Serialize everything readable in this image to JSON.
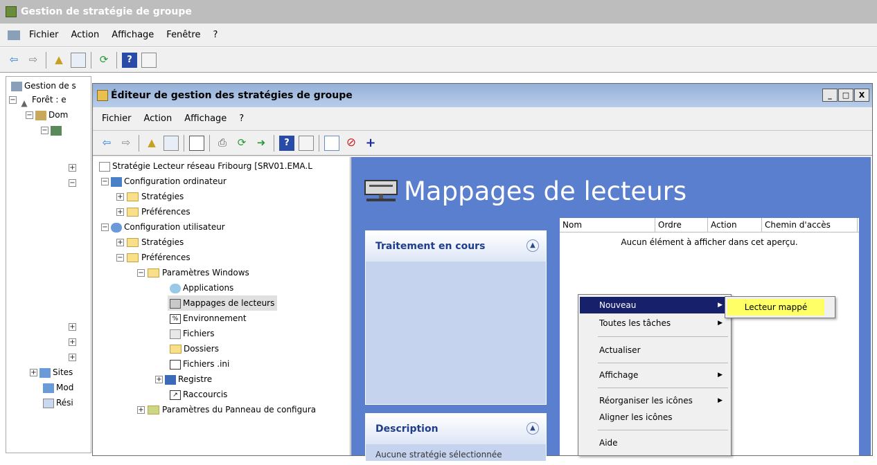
{
  "outer": {
    "title": "Gestion de stratégie de groupe",
    "menu": [
      "Fichier",
      "Action",
      "Affichage",
      "Fenêtre",
      "?"
    ],
    "tree": [
      "Gestion de s",
      "Forêt : e",
      "Dom",
      "Sites",
      "Mod",
      "Rési"
    ]
  },
  "inner": {
    "title": "Éditeur de gestion des stratégies de groupe",
    "window_buttons": [
      "_",
      "□",
      "X"
    ],
    "menu": [
      "Fichier",
      "Action",
      "Affichage",
      "?"
    ],
    "tree": {
      "root": "Stratégie Lecteur réseau Fribourg [SRV01.EMA.L",
      "comp_config": "Configuration ordinateur",
      "comp_strategies": "Stratégies",
      "comp_preferences": "Préférences",
      "user_config": "Configuration utilisateur",
      "user_strategies": "Stratégies",
      "user_preferences": "Préférences",
      "win_params": "Paramètres Windows",
      "applications": "Applications",
      "drive_maps": "Mappages de lecteurs",
      "environment": "Environnement",
      "files": "Fichiers",
      "folders": "Dossiers",
      "ini_files": "Fichiers .ini",
      "registry": "Registre",
      "shortcuts": "Raccourcis",
      "panel_params": "Paramètres du Panneau de configura"
    },
    "pane": {
      "heading": "Mappages de lecteurs",
      "processing": "Traitement en cours",
      "description": "Description",
      "description_text": "Aucune stratégie sélectionnée",
      "columns": [
        "Nom",
        "Ordre",
        "Action",
        "Chemin d'accès"
      ],
      "empty": "Aucun élément à afficher dans cet aperçu."
    }
  },
  "context_menu": {
    "items": [
      "Nouveau",
      "Toutes les tâches",
      "Actualiser",
      "Affichage",
      "Réorganiser les icônes",
      "Aligner les icônes",
      "Aide"
    ],
    "submenu": "Lecteur mappé"
  }
}
